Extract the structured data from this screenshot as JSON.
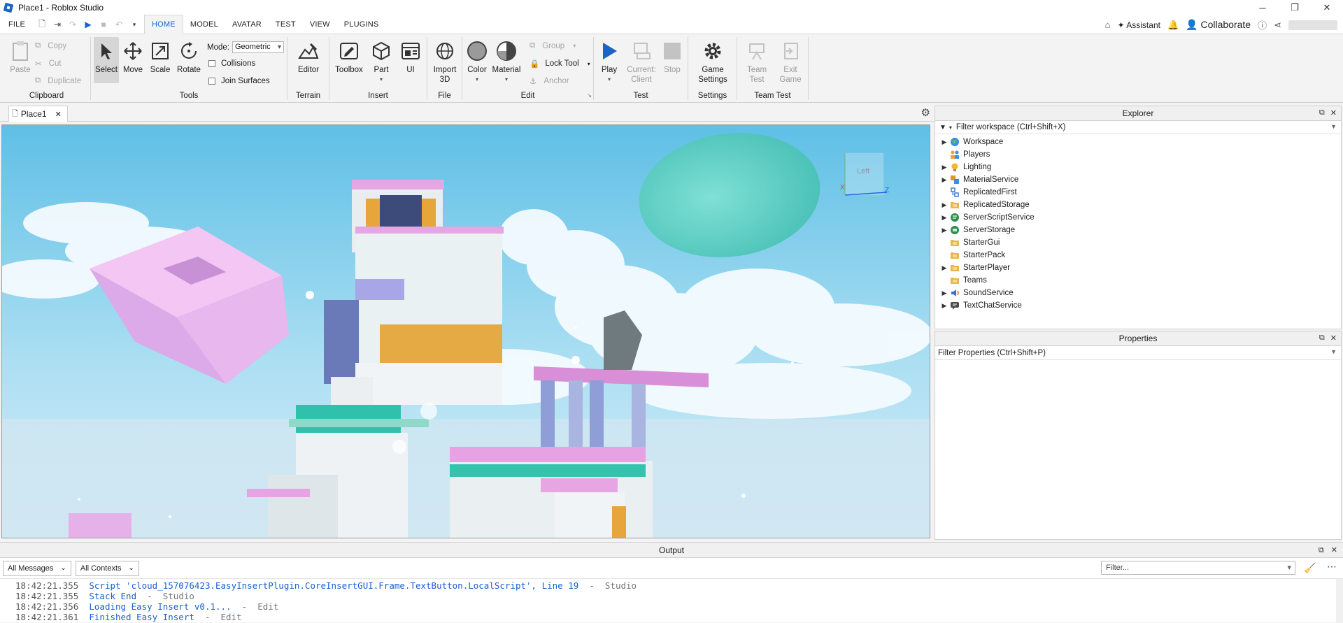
{
  "window": {
    "title": "Place1 - Roblox Studio",
    "minimize": "─",
    "restore": "❐",
    "close": "✕"
  },
  "menu": {
    "file": "FILE",
    "tabs": [
      "HOME",
      "MODEL",
      "AVATAR",
      "TEST",
      "VIEW",
      "PLUGINS"
    ],
    "active_tab": "HOME",
    "right": {
      "assistant": "Assistant",
      "collaborate": "Collaborate"
    }
  },
  "ribbon": {
    "clipboard": {
      "label": "Clipboard",
      "paste": "Paste",
      "copy": "Copy",
      "cut": "Cut",
      "duplicate": "Duplicate"
    },
    "tools": {
      "label": "Tools",
      "select": "Select",
      "move": "Move",
      "scale": "Scale",
      "rotate": "Rotate",
      "mode_label": "Mode:",
      "mode_value": "Geometric",
      "collisions": "Collisions",
      "join_surfaces": "Join Surfaces"
    },
    "terrain": {
      "label": "Terrain",
      "editor": "Editor"
    },
    "insert": {
      "label": "Insert",
      "toolbox": "Toolbox",
      "part": "Part",
      "ui": "UI"
    },
    "file": {
      "label": "File",
      "import_line1": "Import",
      "import_line2": "3D"
    },
    "edit": {
      "label": "Edit",
      "color": "Color",
      "material": "Material",
      "group": "Group",
      "lock_tool": "Lock Tool",
      "anchor": "Anchor"
    },
    "test": {
      "label": "Test",
      "play": "Play",
      "current_line1": "Current:",
      "current_line2": "Client",
      "stop": "Stop"
    },
    "settings": {
      "label": "Settings",
      "game_line1": "Game",
      "game_line2": "Settings"
    },
    "team_test": {
      "label": "Team Test",
      "team_line1": "Team",
      "team_line2": "Test",
      "exit_line1": "Exit",
      "exit_line2": "Game"
    }
  },
  "doc_tab": {
    "label": "Place1"
  },
  "viewport": {
    "view_cube_label": "Left",
    "axis_z": "Z",
    "axis_x": "X"
  },
  "explorer": {
    "title": "Explorer",
    "filter": "Filter workspace (Ctrl+Shift+X)",
    "items": [
      {
        "label": "Workspace",
        "expandable": true,
        "icon": "globe-icon"
      },
      {
        "label": "Players",
        "expandable": false,
        "icon": "players-icon"
      },
      {
        "label": "Lighting",
        "expandable": true,
        "icon": "lightbulb-icon"
      },
      {
        "label": "MaterialService",
        "expandable": true,
        "icon": "material-icon"
      },
      {
        "label": "ReplicatedFirst",
        "expandable": false,
        "icon": "replicated-first-icon"
      },
      {
        "label": "ReplicatedStorage",
        "expandable": true,
        "icon": "folder-icon"
      },
      {
        "label": "ServerScriptService",
        "expandable": true,
        "icon": "server-script-icon"
      },
      {
        "label": "ServerStorage",
        "expandable": true,
        "icon": "server-storage-icon"
      },
      {
        "label": "StarterGui",
        "expandable": false,
        "icon": "folder-icon"
      },
      {
        "label": "StarterPack",
        "expandable": false,
        "icon": "folder-icon"
      },
      {
        "label": "StarterPlayer",
        "expandable": true,
        "icon": "folder-icon"
      },
      {
        "label": "Teams",
        "expandable": false,
        "icon": "folder-icon"
      },
      {
        "label": "SoundService",
        "expandable": true,
        "icon": "sound-icon"
      },
      {
        "label": "TextChatService",
        "expandable": true,
        "icon": "chat-icon"
      }
    ]
  },
  "properties": {
    "title": "Properties",
    "filter": "Filter Properties (Ctrl+Shift+P)"
  },
  "output": {
    "title": "Output",
    "messages_filter": "All Messages",
    "contexts_filter": "All Contexts",
    "filter_placeholder": "Filter...",
    "lines": [
      {
        "time": "18:42:21.355",
        "text": "Script 'cloud_157076423.EasyInsertPlugin.CoreInsertGUI.Frame.TextButton.LocalScript', Line 19",
        "context": "Studio"
      },
      {
        "time": "18:42:21.355",
        "text": "Stack End",
        "context": "Studio"
      },
      {
        "time": "18:42:21.356",
        "text": "Loading Easy Insert v0.1...",
        "context": "Edit"
      },
      {
        "time": "18:42:21.361",
        "text": "Finished Easy Insert",
        "context": "Edit"
      }
    ]
  },
  "colors": {
    "accent": "#1a64c8",
    "sky": "#8fd3ef"
  }
}
